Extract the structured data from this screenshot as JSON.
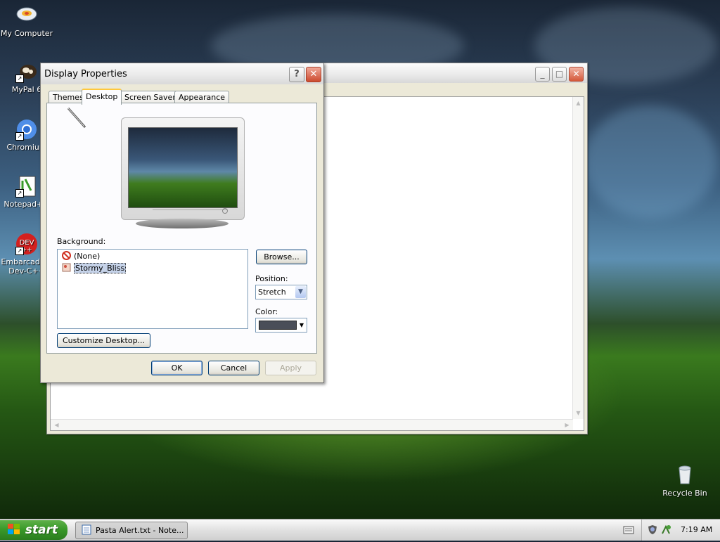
{
  "desktop_icons": [
    {
      "name": "my-computer",
      "label": "My Computer"
    },
    {
      "name": "mypal",
      "label": "MyPal 6"
    },
    {
      "name": "chromium",
      "label": "Chromium"
    },
    {
      "name": "notepadpp",
      "label": "Notepad++"
    },
    {
      "name": "devcpp",
      "label": "Embarcadero Dev-C++"
    },
    {
      "name": "recycle-bin",
      "label": "Recycle Bin"
    }
  ],
  "notepad_window": {
    "title": ""
  },
  "dialog": {
    "title": "Display Properties",
    "help_glyph": "?",
    "close_glyph": "✕",
    "tabs": [
      "Themes",
      "Desktop",
      "Screen Saver",
      "Appearance"
    ],
    "active_tab": "Desktop",
    "background_label": "Background:",
    "backgrounds": [
      "(None)",
      "Stormy_Bliss"
    ],
    "selected_background": "Stormy_Bliss",
    "browse_button": "Browse...",
    "position_label": "Position:",
    "position_value": "Stretch",
    "color_label": "Color:",
    "color_value": "#4a4e58",
    "customize_button": "Customize Desktop...",
    "ok_button": "OK",
    "cancel_button": "Cancel",
    "apply_button": "Apply"
  },
  "taskbar": {
    "start_label": "start",
    "task_label": "Pasta Alert.txt - Note...",
    "clock": "7:19 AM"
  }
}
